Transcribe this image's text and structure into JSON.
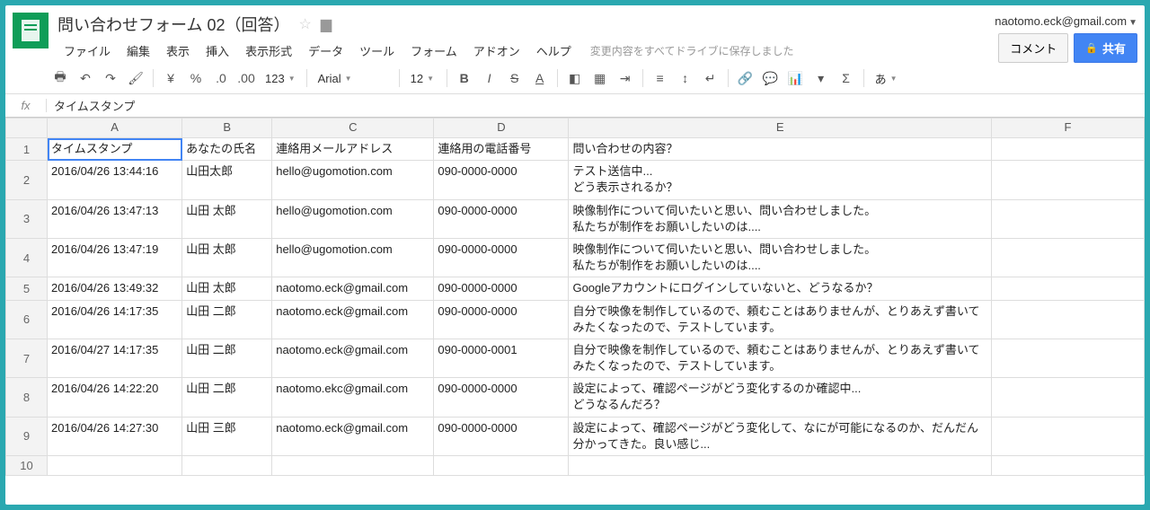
{
  "header": {
    "doc_title": "問い合わせフォーム 02（回答）",
    "user_email": "naotomo.eck@gmail.com",
    "comment_btn": "コメント",
    "share_btn": "共有",
    "save_status": "変更内容をすべてドライブに保存しました"
  },
  "menus": [
    "ファイル",
    "編集",
    "表示",
    "挿入",
    "表示形式",
    "データ",
    "ツール",
    "フォーム",
    "アドオン",
    "ヘルプ"
  ],
  "toolbar": {
    "font": "Arial",
    "font_size": "12",
    "number_format": "123"
  },
  "fx": {
    "label": "fx",
    "value": "タイムスタンプ"
  },
  "columns": [
    "A",
    "B",
    "C",
    "D",
    "E",
    "F"
  ],
  "selected_cell": "A1",
  "rows": [
    {
      "n": 1,
      "cells": [
        "タイムスタンプ",
        "あなたの氏名",
        "連絡用メールアドレス",
        "連絡用の電話番号",
        "問い合わせの内容？",
        ""
      ]
    },
    {
      "n": 2,
      "cells": [
        "2016/04/26 13:44:16",
        "山田太郎",
        "hello@ugomotion.com",
        "090-0000-0000",
        "テスト送信中...\nどう表示されるか？",
        ""
      ]
    },
    {
      "n": 3,
      "cells": [
        "2016/04/26 13:47:13",
        "山田 太郎",
        "hello@ugomotion.com",
        "090-0000-0000",
        "映像制作について伺いたいと思い、問い合わせしました。\n私たちが制作をお願いしたいのは....",
        ""
      ]
    },
    {
      "n": 4,
      "cells": [
        "2016/04/26 13:47:19",
        "山田 太郎",
        "hello@ugomotion.com",
        "090-0000-0000",
        "映像制作について伺いたいと思い、問い合わせしました。\n私たちが制作をお願いしたいのは....",
        ""
      ]
    },
    {
      "n": 5,
      "cells": [
        "2016/04/26 13:49:32",
        "山田 太郎",
        "naotomo.eck@gmail.com",
        "090-0000-0000",
        "Googleアカウントにログインしていないと、どうなるか？",
        ""
      ]
    },
    {
      "n": 6,
      "cells": [
        "2016/04/26 14:17:35",
        "山田 二郎",
        "naotomo.eck@gmail.com",
        "090-0000-0000",
        "自分で映像を制作しているので、頼むことはありませんが、とりあえず書いてみたくなったので、テストしています。",
        ""
      ]
    },
    {
      "n": 7,
      "cells": [
        "2016/04/27 14:17:35",
        "山田 二郎",
        "naotomo.eck@gmail.com",
        "090-0000-0001",
        "自分で映像を制作しているので、頼むことはありませんが、とりあえず書いてみたくなったので、テストしています。",
        ""
      ]
    },
    {
      "n": 8,
      "cells": [
        "2016/04/26 14:22:20",
        "山田 二郎",
        "naotomo.ekc@gmail.com",
        "090-0000-0000",
        "設定によって、確認ページがどう変化するのか確認中...\nどうなるんだろ？",
        ""
      ]
    },
    {
      "n": 9,
      "cells": [
        "2016/04/26 14:27:30",
        "山田 三郎",
        "naotomo.eck@gmail.com",
        "090-0000-0000",
        "設定によって、確認ページがどう変化して、なにが可能になるのか、だんだん分かってきた。良い感じ...",
        ""
      ]
    },
    {
      "n": 10,
      "cells": [
        "",
        "",
        "",
        "",
        "",
        ""
      ]
    }
  ]
}
